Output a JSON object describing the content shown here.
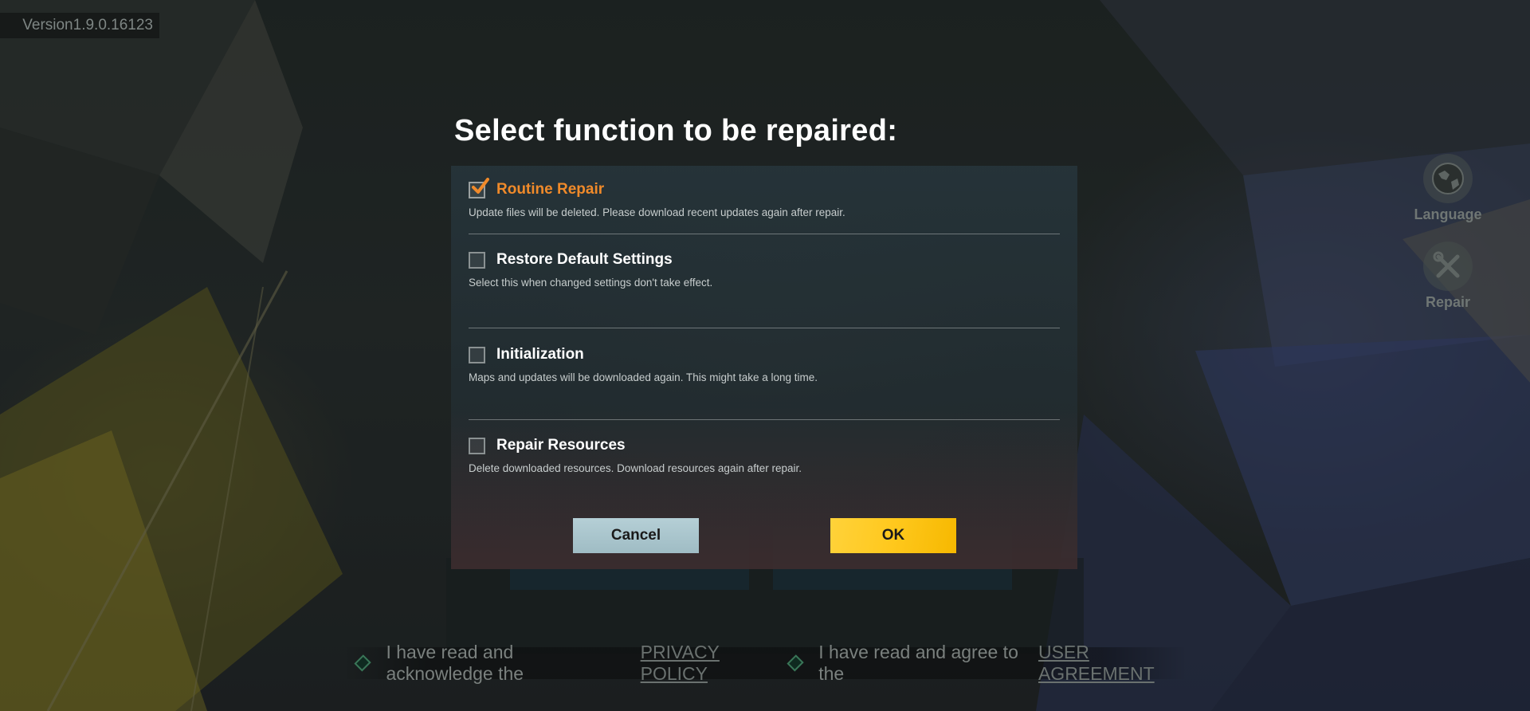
{
  "version": "Version1.9.0.16123",
  "side": {
    "language_label": "Language",
    "repair_label": "Repair"
  },
  "dialog": {
    "title": "Select function to be repaired:",
    "options": [
      {
        "label": "Routine Repair",
        "description": "Update files will be deleted. Please download recent updates again after repair.",
        "checked": true
      },
      {
        "label": "Restore Default Settings",
        "description": "Select this when changed settings don't take effect.",
        "checked": false
      },
      {
        "label": "Initialization",
        "description": "Maps and updates will be downloaded again. This might take a long time.",
        "checked": false
      },
      {
        "label": "Repair Resources",
        "description": "Delete downloaded resources. Download resources again after repair.",
        "checked": false
      }
    ],
    "cancel_label": "Cancel",
    "ok_label": "OK"
  },
  "agreements": {
    "privacy_text": "I have read and acknowledge the",
    "privacy_link": "PRIVACY POLICY",
    "user_text": "I have read and agree to the",
    "user_link": "USER AGREEMENT"
  },
  "colors": {
    "accent_orange": "#f08a2a",
    "ok_yellow": "#ffc81d",
    "cancel_blue": "#a8c4cc"
  }
}
